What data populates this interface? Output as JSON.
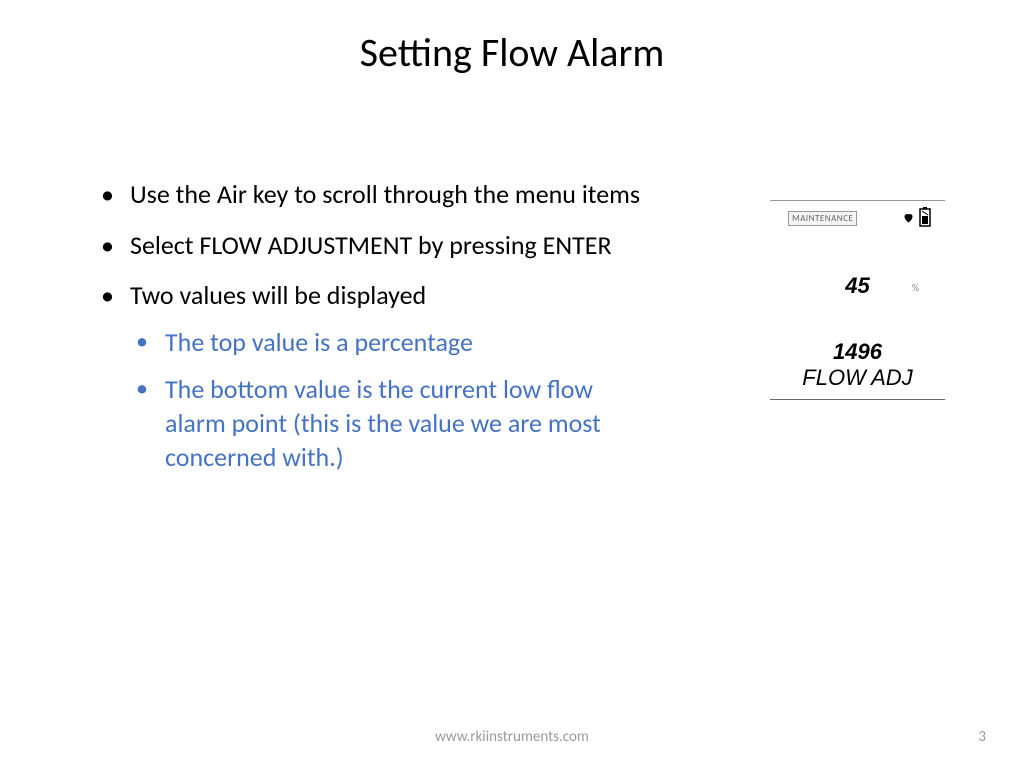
{
  "title": "Setting Flow Alarm",
  "bullets": {
    "b1": "Use the Air key to scroll through the menu items",
    "b2": "Select FLOW ADJUSTMENT by pressing ENTER",
    "b3": "Two values will be displayed",
    "sub1": "The top value is a percentage",
    "sub2": "The bottom value is the current low flow alarm point (this is the value we are most concerned with.)"
  },
  "device": {
    "mode_badge": "MAINTENANCE",
    "value_top": "45",
    "percent_symbol": "%",
    "value_bottom": "1496",
    "label": "FLOW ADJ"
  },
  "footer": {
    "url": "www.rkiinstruments.com",
    "page": "3"
  }
}
